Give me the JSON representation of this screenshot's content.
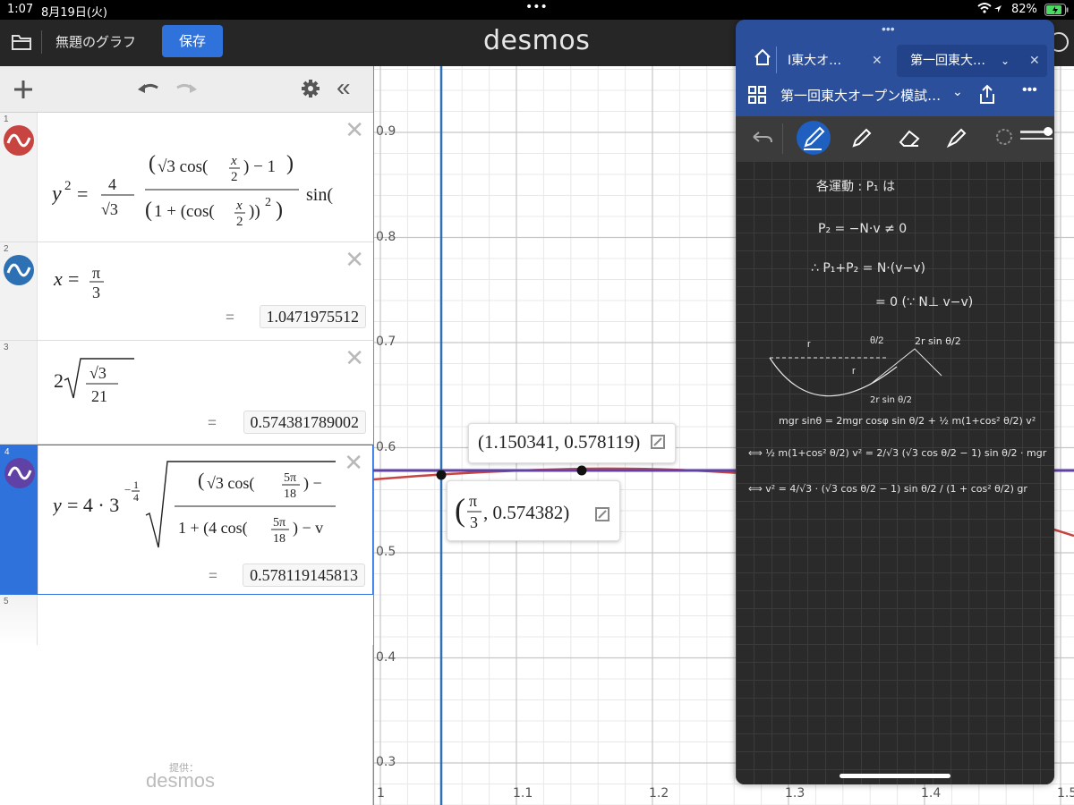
{
  "status_bar": {
    "time": "1:07",
    "date": "8月19日(火)",
    "battery": "82%",
    "dots": "•••"
  },
  "desmos": {
    "title": "無題のグラフ",
    "save_label": "保存",
    "logo": "desmos",
    "powered_by": "提供：",
    "footer_logo": "desmos"
  },
  "expressions": [
    {
      "num": "1",
      "latex_display": "y² = 4/√3 · (√3 cos(x/2) − 1) / (1 + (cos(x/2))²) · sin(",
      "color": "#c74440"
    },
    {
      "num": "2",
      "latex_display": "x = π/3",
      "result": "1.0471975512",
      "color": "#2d70b3"
    },
    {
      "num": "3",
      "latex_display": "2√(√3/21)",
      "result": "0.574381789002"
    },
    {
      "num": "4",
      "latex_display": "y = 4 · 3^(−1/4) √( (√3 cos(5π/18) − ) / (1 + (4 cos(5π/18) − v )",
      "result": "0.578119145813",
      "color": "#6042a6"
    },
    {
      "num": "5"
    }
  ],
  "graph": {
    "y_ticks": [
      "0.9",
      "0.8",
      "0.7",
      "0.6",
      "0.5",
      "0.4",
      "0.3"
    ],
    "x_ticks": [
      "1",
      "1.1",
      "1.2",
      "1.3",
      "1.4",
      "1.5"
    ],
    "point_label_1": "(1.150341, 0.578119)",
    "point_label_2_val": ", 0.574382)",
    "point_label_2_num": "π",
    "point_label_2_den": "3",
    "colors": {
      "red": "#c74440",
      "blue": "#2d70b3",
      "purple": "#6042a6"
    }
  },
  "notes": {
    "tab1": "I東大オ…",
    "tab2": "第一回東大…",
    "notebook_title": "第一回東大オープン模試…",
    "lines": [
      "各運動 : P₁ は",
      "P₂ = −N·v ≠ 0",
      "∴ P₁+P₂ = N·(v−v)",
      "= 0  (∵ N⊥ v−v)",
      "2r sin θ/2",
      "2r sin θ/2",
      "mgr sinθ = 2mgr cosφ sin θ/2 + ½ m(1+cos² θ/2) v²",
      "⟺ ½ m(1+cos² θ/2) v² = 2/√3 (√3 cos θ/2 − 1) sin θ/2 · mgr",
      "⟺ v² = 4/√3 · (√3 cos θ/2 − 1) sin θ/2 / (1 + cos² θ/2) gr"
    ]
  }
}
